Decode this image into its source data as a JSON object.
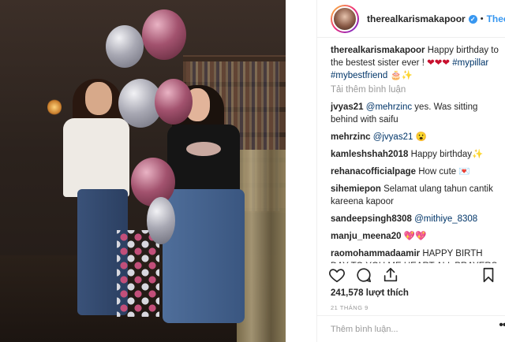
{
  "post": {
    "username": "therealkarismakapoor",
    "follow_label": "Theo dõi",
    "separator": "•",
    "verified_icon": "verified-badge-icon"
  },
  "caption": {
    "username": "therealkarismakapoor",
    "text": "Happy birthday to the bestest sister ever ! ",
    "hearts": "❤❤❤",
    "tags": [
      "#mypillar",
      "#mybestfriend"
    ],
    "emoji": "🎂✨"
  },
  "load_more": "Tải thêm bình luận",
  "comments": [
    {
      "user": "jvyas21",
      "mention": "@mehrzinc",
      "text": " yes. Was sitting behind with saifu"
    },
    {
      "user": "mehrzinc",
      "mention": "@jvyas21",
      "text": " 😮"
    },
    {
      "user": "kamleshshah2018",
      "mention": "",
      "text": "Happy birthday✨"
    },
    {
      "user": "rehanacofficialpage",
      "mention": "",
      "text": "How cute 💌"
    },
    {
      "user": "sihemiepon",
      "mention": "",
      "text": "Selamat ulang tahun cantik kareena kapoor"
    },
    {
      "user": "sandeepsingh8308",
      "mention": "@mithiye_8308",
      "text": ""
    },
    {
      "user": "manju_meena20",
      "mention": "",
      "text": "💖💖"
    },
    {
      "user": "raomohammadaamir",
      "mention": "",
      "text": "HAPPY BIRTH DAY TO YOU ME HEART ALL PRAYERS ALL LIFE AND FULL TIME IN HAPPNING WISHING ENJOYMENT AND CELEBRATION TRUST ME"
    }
  ],
  "actions": {
    "like": "heart-icon",
    "comment": "comment-icon",
    "share": "share-icon",
    "save": "bookmark-icon"
  },
  "likes_text": "241,578 lượt thích",
  "date": "21 THÁNG 9",
  "add_comment_placeholder": "Thêm bình luận...",
  "menu_glyph": "•••"
}
